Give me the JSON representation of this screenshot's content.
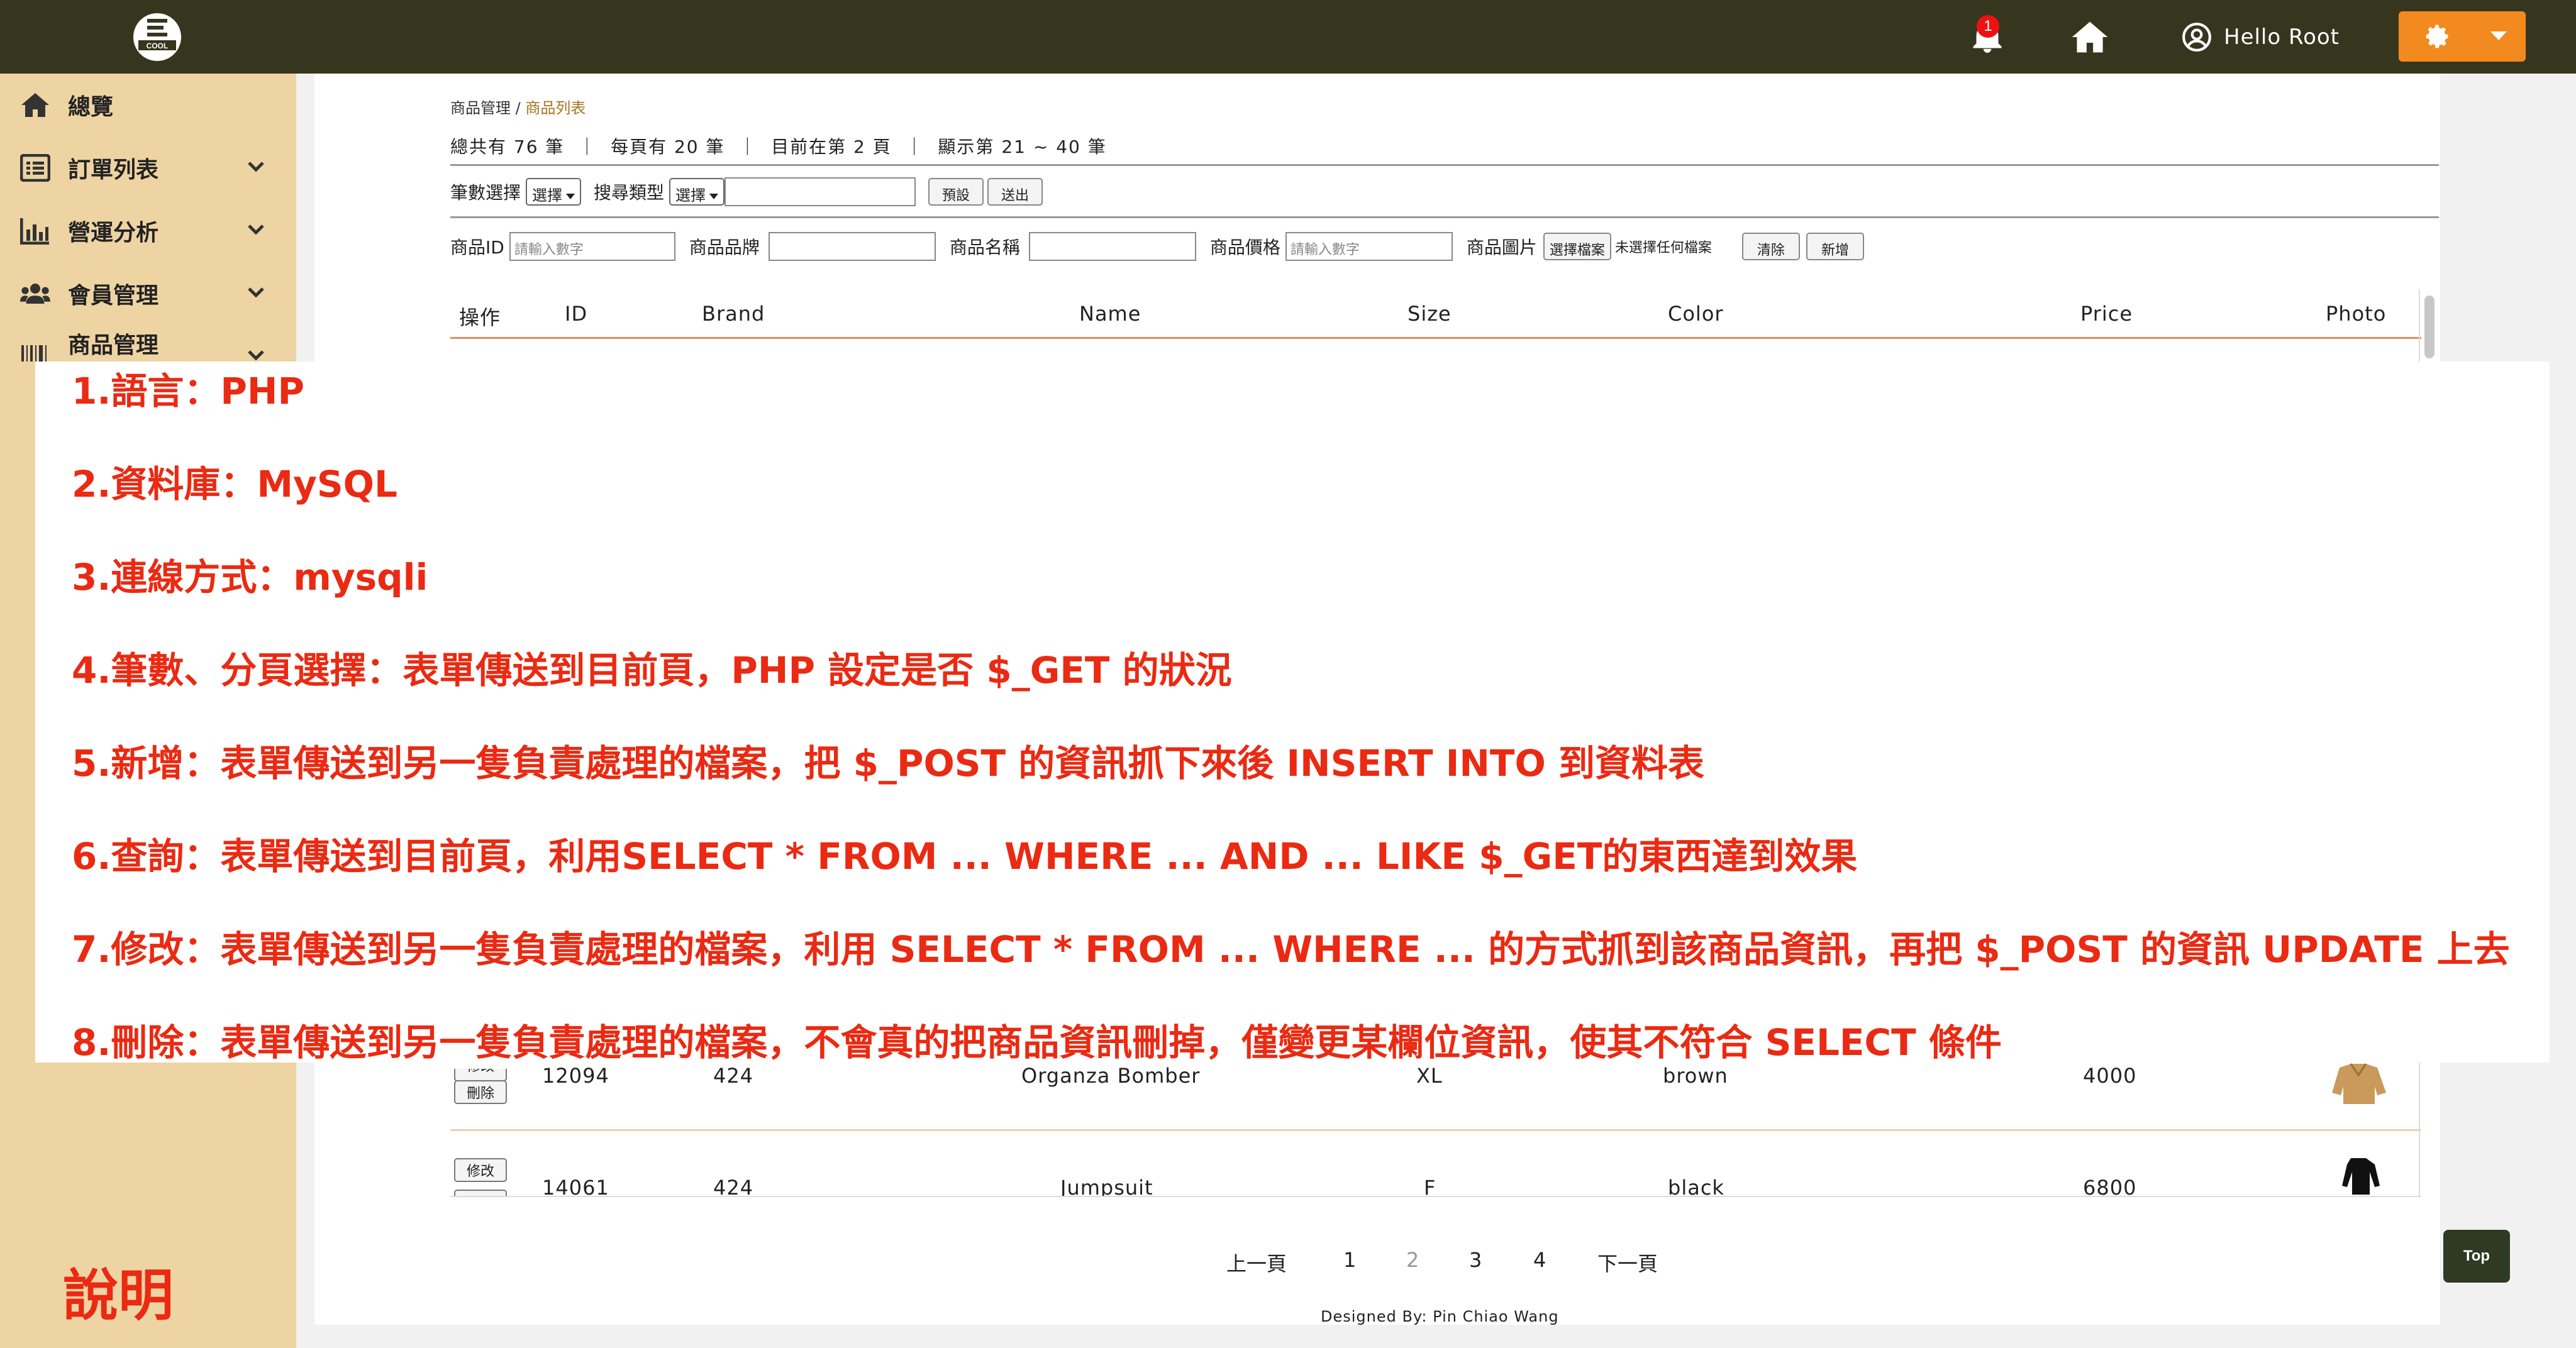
{
  "topbar": {
    "notification_count": "1",
    "user_greeting": "Hello Root"
  },
  "sidebar": {
    "items": [
      {
        "label": "總覽",
        "icon": "home-icon"
      },
      {
        "label": "訂單列表",
        "icon": "list-icon"
      },
      {
        "label": "營運分析",
        "icon": "chart-icon"
      },
      {
        "label": "會員管理",
        "icon": "users-icon"
      },
      {
        "label": "商品管理",
        "icon": "barcode-icon"
      }
    ],
    "footer_label": "說明"
  },
  "breadcrumb": {
    "parent": "商品管理",
    "separator": " / ",
    "current": "商品列表"
  },
  "stats": {
    "total": "總共有 76 筆",
    "per_page": "每頁有 20 筆",
    "current_page": "目前在第 2 頁",
    "showing": "顯示第 21 ~ 40 筆",
    "divider": "｜"
  },
  "filter_form": {
    "count_label": "筆數選擇",
    "count_select": "選擇",
    "search_type_label": "搜尋類型",
    "search_type_select": "選擇",
    "search_value": "",
    "default_button": "預設",
    "submit_button": "送出"
  },
  "add_form": {
    "id_label": "商品ID",
    "id_placeholder": "請輸入數字",
    "brand_label": "商品品牌",
    "name_label": "商品名稱",
    "price_label": "商品價格",
    "price_placeholder": "請輸入數字",
    "image_label": "商品圖片",
    "choose_file_button": "選擇檔案",
    "no_file_text": "未選擇任何檔案",
    "clear_button": "清除",
    "add_button": "新增"
  },
  "table": {
    "headers": [
      "操作",
      "ID",
      "Brand",
      "Name",
      "Size",
      "Color",
      "Price",
      "Photo"
    ],
    "rows": [
      {
        "edit": "修改",
        "delete": "刪除",
        "id": "12094",
        "brand": "424",
        "name": "Organza Bomber",
        "size": "XL",
        "color": "brown",
        "price": "4000",
        "photo": "jacket-photo"
      },
      {
        "edit": "修改",
        "delete": "刪除",
        "id": "14061",
        "brand": "424",
        "name": "Jumpsuit",
        "size": "F",
        "color": "black",
        "price": "6800",
        "photo": "jumpsuit-photo"
      }
    ]
  },
  "pagination": {
    "prev": "上一頁",
    "pages": [
      "1",
      "2",
      "3",
      "4"
    ],
    "current": "2",
    "next": "下一頁"
  },
  "footer": {
    "credit": "Designed By: Pin Chiao Wang"
  },
  "top_button": "Top",
  "notes": [
    "1.語言：PHP",
    "2.資料庫：MySQL",
    "3.連線方式：mysqli",
    "4.筆數、分頁選擇：表單傳送到目前頁，PHP 設定是否 $_GET 的狀況",
    "5.新增：表單傳送到另一隻負責處理的檔案，把 $_POST 的資訊抓下來後 INSERT INTO 到資料表",
    "6.查詢：表單傳送到目前頁，利用SELECT * FROM ... WHERE ... AND ... LIKE $_GET的東西達到效果",
    "7.修改：表單傳送到另一隻負責處理的檔案，利用 SELECT * FROM ... WHERE ... 的方式抓到該商品資訊，再把 $_POST 的資訊 UPDATE 上去",
    "8.刪除：表單傳送到另一隻負責處理的檔案，不會真的把商品資訊刪掉，僅變更某欄位資訊，使其不符合 SELECT 條件"
  ],
  "colors": {
    "topbar": "#36361f",
    "sidebar": "#eed4a3",
    "accent_orange": "#f28a1f",
    "note_red": "#ea2a12"
  }
}
